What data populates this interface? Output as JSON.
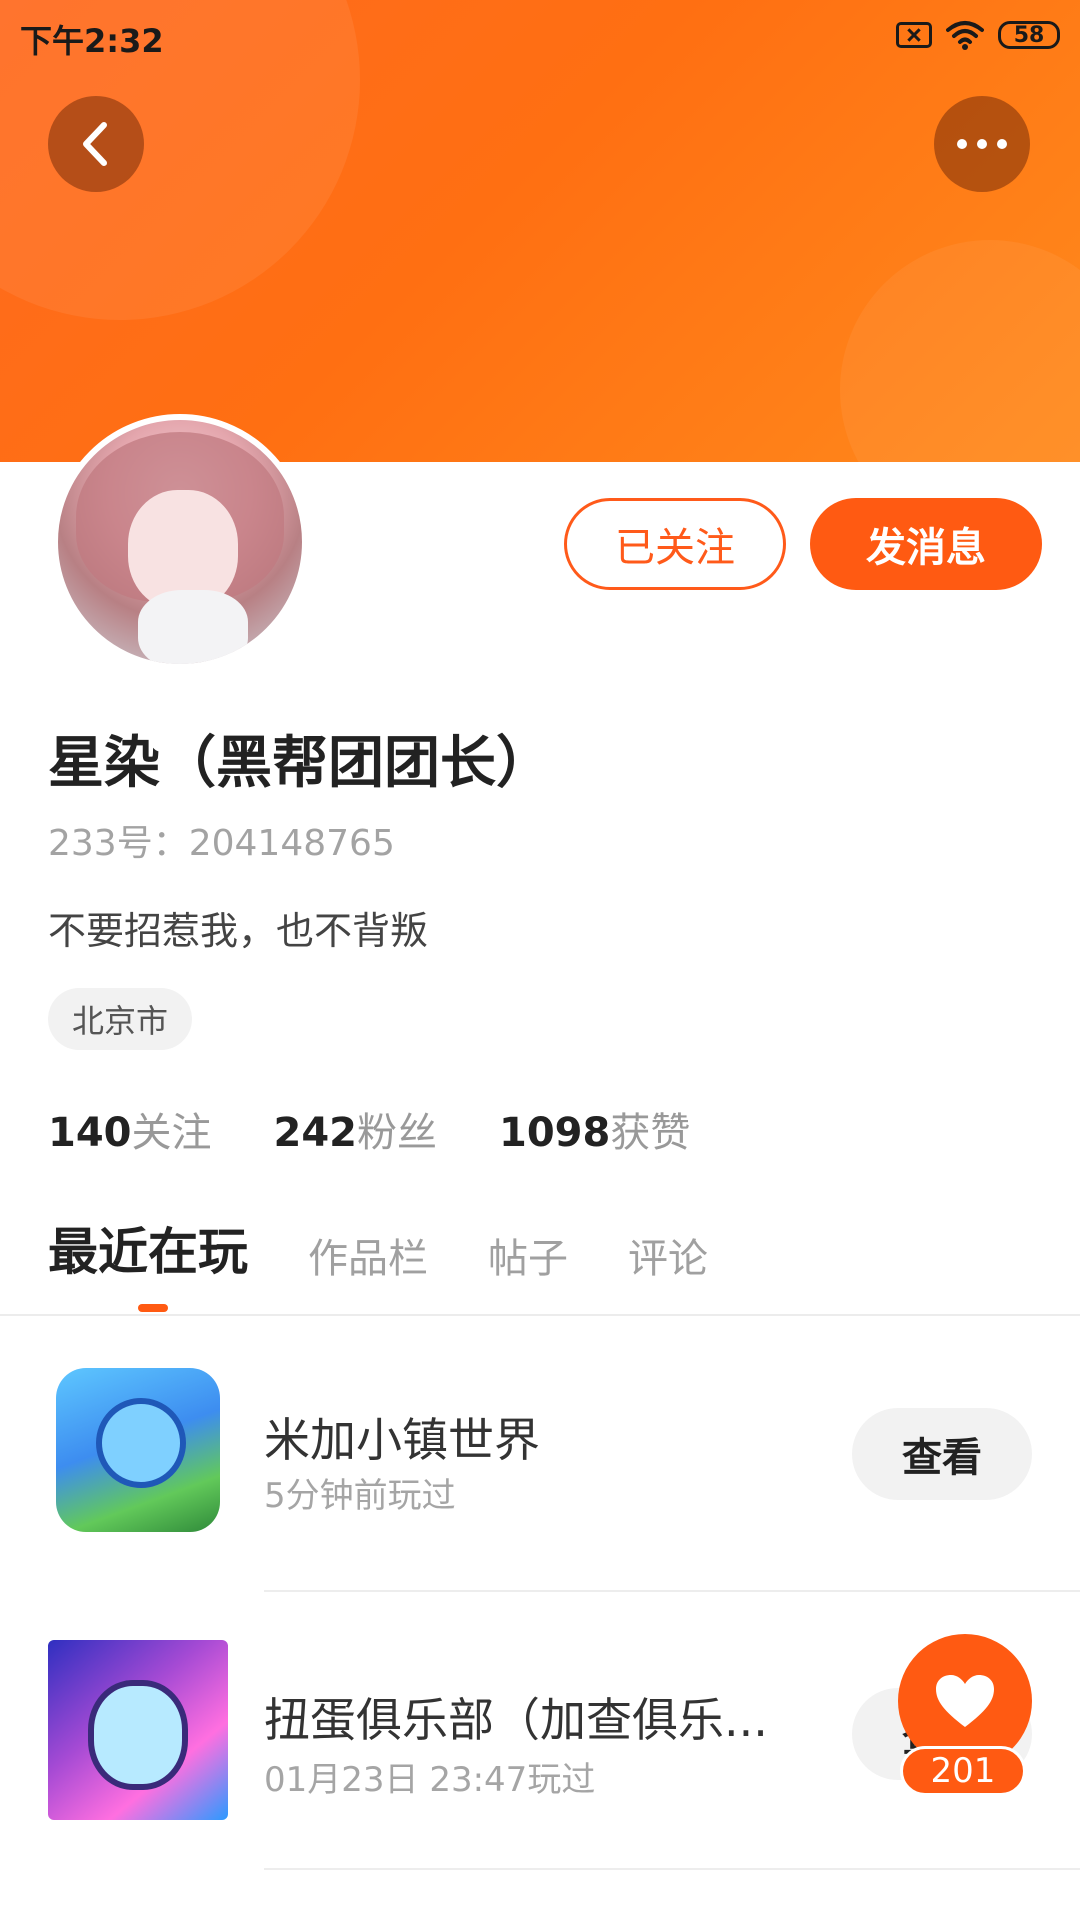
{
  "status_bar": {
    "time": "下午2:32",
    "battery": "58"
  },
  "header": {
    "back_icon": "chevron-left-icon",
    "more_icon": "more-dots-icon"
  },
  "profile": {
    "follow_status_label": "已关注",
    "message_label": "发消息",
    "nickname": "星染（黑帮团团长）",
    "id_label": "233号：",
    "id_value": "204148765",
    "bio": "不要招惹我，也不背叛",
    "location": "北京市"
  },
  "stats": {
    "following_count": "140",
    "following_label": "关注",
    "fans_count": "242",
    "fans_label": "粉丝",
    "likes_count": "1098",
    "likes_label": "获赞"
  },
  "tabs": [
    {
      "label": "最近在玩",
      "active": true
    },
    {
      "label": "作品栏",
      "active": false
    },
    {
      "label": "帖子",
      "active": false
    },
    {
      "label": "评论",
      "active": false
    }
  ],
  "recent_games": [
    {
      "title": "米加小镇世界",
      "subtitle": "5分钟前玩过",
      "action": "查看"
    },
    {
      "title": "扭蛋俱乐部（加查俱乐...",
      "subtitle": "01月23日 23:47玩过",
      "action": "查看"
    }
  ],
  "like_fab": {
    "count": "201"
  },
  "colors": {
    "accent": "#ff5a12",
    "header_start": "#ff6a1f",
    "header_end": "#ff8a1c"
  }
}
